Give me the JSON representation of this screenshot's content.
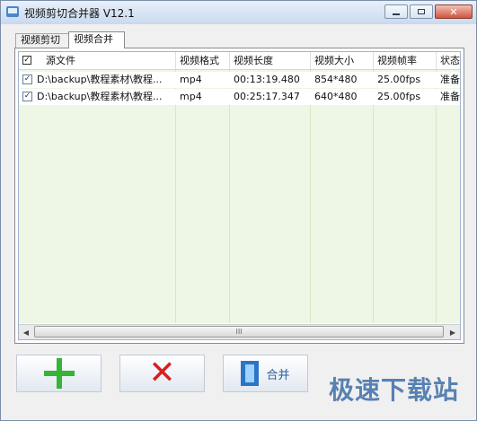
{
  "window": {
    "title": "视频剪切合并器 V12.1"
  },
  "tabs": [
    {
      "label": "视频剪切",
      "active": false
    },
    {
      "label": "视频合并",
      "active": true
    }
  ],
  "table": {
    "header_checked": true,
    "columns": [
      "源文件",
      "视频格式",
      "视频长度",
      "视频大小",
      "视频帧率",
      "状态"
    ],
    "rows": [
      {
        "checked": true,
        "file": "D:\\backup\\教程素材\\教程...",
        "format": "mp4",
        "duration": "00:13:19.480",
        "size": "854*480",
        "fps": "25.00fps",
        "status": "准备"
      },
      {
        "checked": true,
        "file": "D:\\backup\\教程素材\\教程...",
        "format": "mp4",
        "duration": "00:25:17.347",
        "size": "640*480",
        "fps": "25.00fps",
        "status": "准备"
      }
    ]
  },
  "scrollbar": {
    "grip": "III",
    "left_arrow": "◀",
    "right_arrow": "▶"
  },
  "buttons": {
    "add_icon": "plus-icon",
    "remove_icon": "x-icon",
    "merge_label": "合并",
    "merge_icon": "film-icon"
  },
  "watermark": "极速下载站",
  "colors": {
    "add": "#34b535",
    "remove": "#d62020",
    "list_bg": "#eef7e6"
  }
}
